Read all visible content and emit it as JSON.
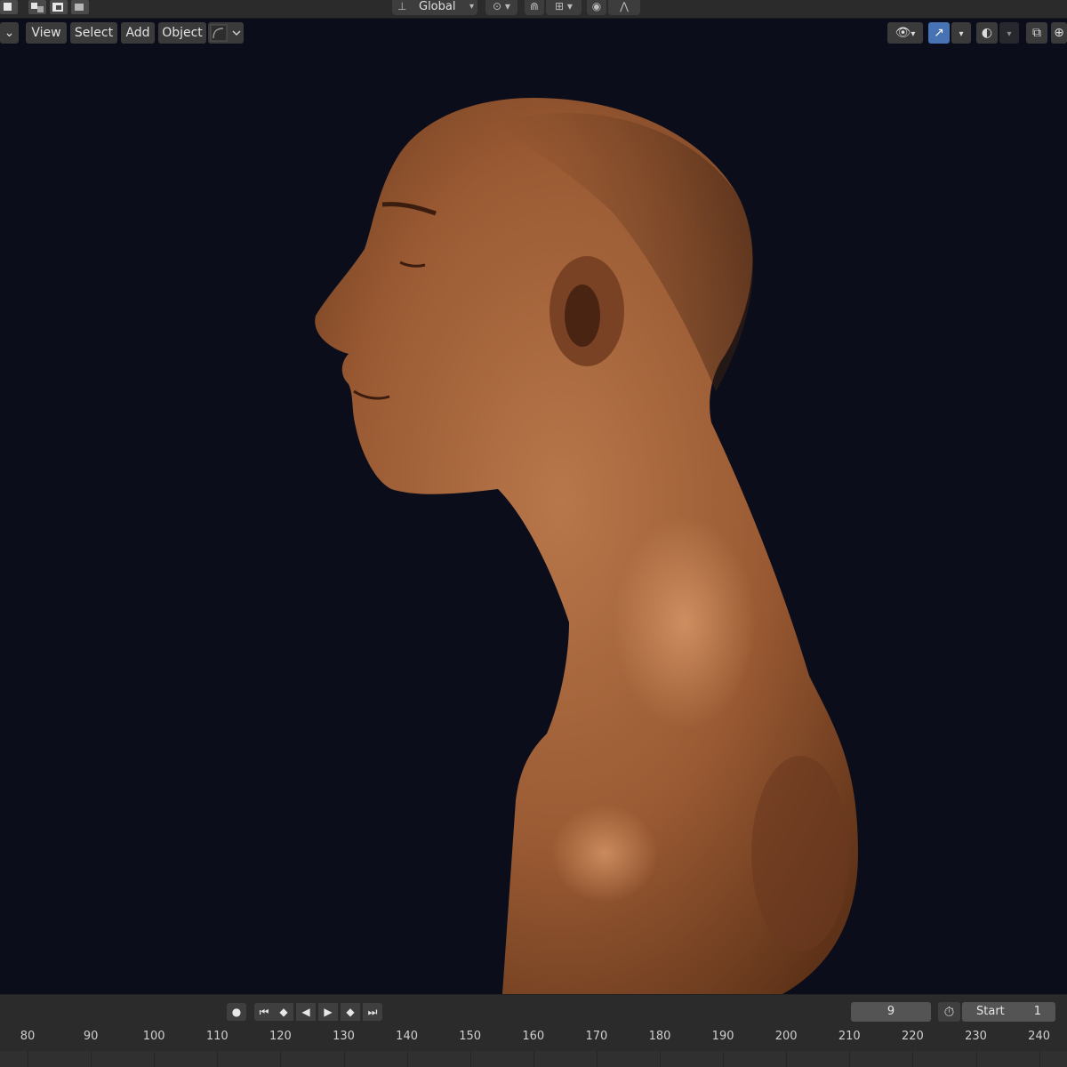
{
  "header": {
    "transform_orientation": "Global"
  },
  "viewport_header": {
    "mode_chevron": "⌄",
    "menus": [
      "View",
      "Select",
      "Add",
      "Object"
    ]
  },
  "icons": {
    "select_modes": [
      "select-box-icon",
      "select-extend-icon",
      "select-subtract-icon",
      "select-intersect-icon"
    ],
    "orientation": "transform-orientation-icon",
    "pivot": "pivot-point-icon",
    "snap": "snap-magnet-icon",
    "snap_target": "snap-increment-icon",
    "proportional": "proportional-edit-icon",
    "falloff": "falloff-curve-icon",
    "visibility": "eye-icon",
    "gizmo": "gizmo-icon",
    "overlays": "overlays-icon",
    "xray": "xray-icon",
    "shading": "shading-wireframe-icon"
  },
  "colors": {
    "viewport_bg": "#0b0d1a",
    "panel": "#2b2b2b",
    "button": "#3a3a3a",
    "active_blue": "#4772b3",
    "skin": "#a5643c"
  },
  "playback": {
    "current_frame": "9",
    "start_label": "Start",
    "start_value": "1"
  },
  "timeline": {
    "ticks": [
      "80",
      "90",
      "100",
      "110",
      "120",
      "130",
      "140",
      "150",
      "160",
      "170",
      "180",
      "190",
      "200",
      "210",
      "220",
      "230",
      "240"
    ]
  }
}
